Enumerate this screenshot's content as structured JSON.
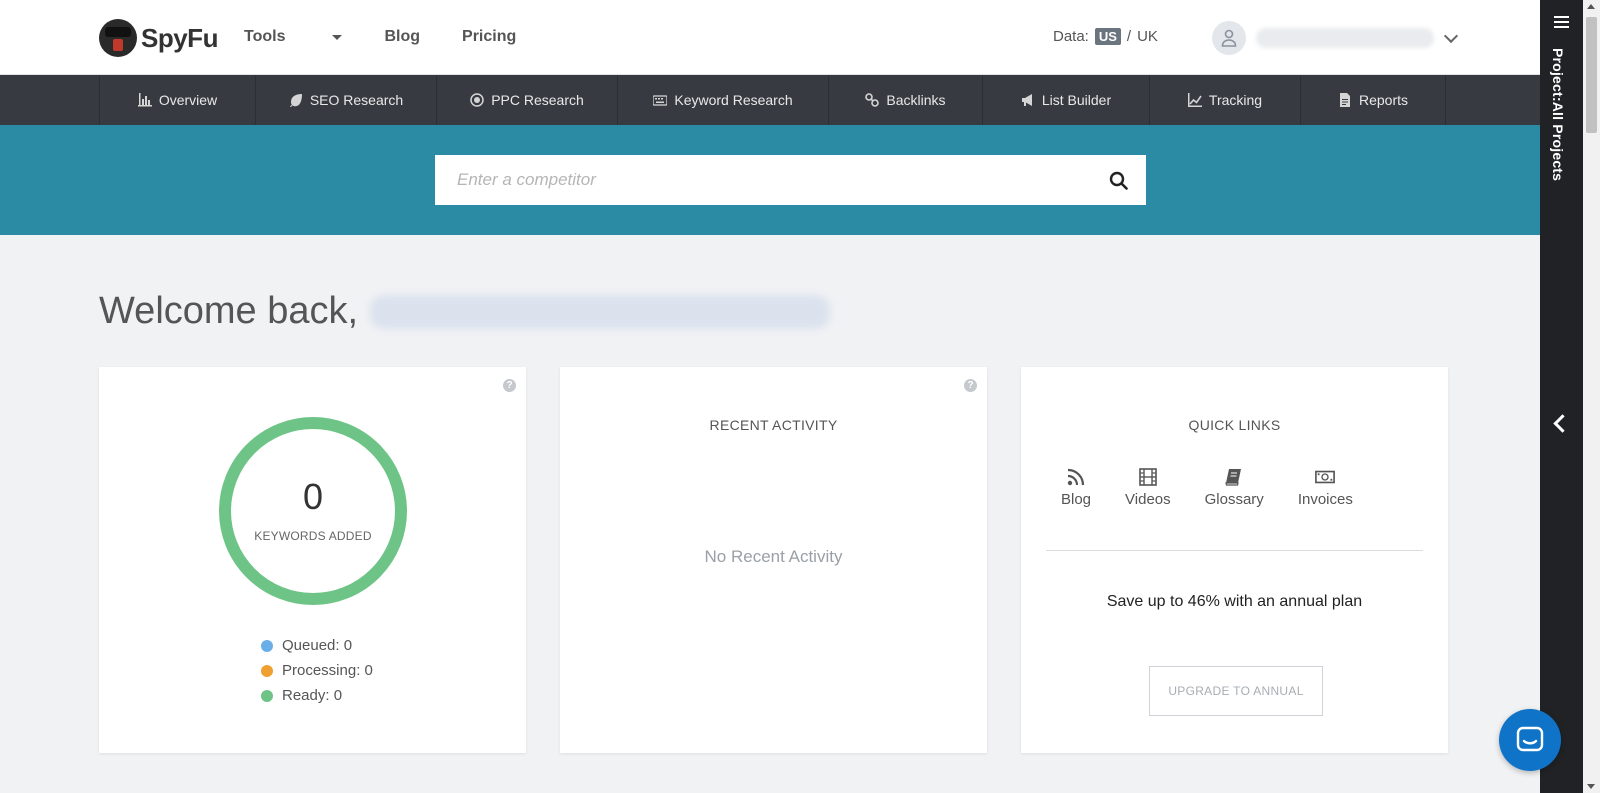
{
  "header": {
    "logo_text": "SpyFu",
    "nav": [
      {
        "label": "Tools"
      },
      {
        "label": "Blog"
      },
      {
        "label": "Pricing"
      }
    ],
    "data_label": "Data:",
    "data_us": "US",
    "data_sep": "/",
    "data_uk": "UK"
  },
  "toolnav": [
    {
      "label": "Overview",
      "icon": "bar-chart-icon"
    },
    {
      "label": "SEO Research",
      "icon": "leaf-icon"
    },
    {
      "label": "PPC Research",
      "icon": "target-icon"
    },
    {
      "label": "Keyword Research",
      "icon": "keyboard-icon"
    },
    {
      "label": "Backlinks",
      "icon": "link-icon"
    },
    {
      "label": "List Builder",
      "icon": "megaphone-icon"
    },
    {
      "label": "Tracking",
      "icon": "line-chart-icon"
    },
    {
      "label": "Reports",
      "icon": "document-icon"
    }
  ],
  "search": {
    "placeholder": "Enter a competitor"
  },
  "welcome": {
    "text": "Welcome back,"
  },
  "keywords_card": {
    "count": "0",
    "label": "KEYWORDS ADDED",
    "legend": [
      {
        "label": "Queued: 0",
        "color": "#6aaee8"
      },
      {
        "label": "Processing: 0",
        "color": "#f0a030"
      },
      {
        "label": "Ready: 0",
        "color": "#6ec486"
      }
    ],
    "ring_color": "#6ec486"
  },
  "activity_card": {
    "title": "RECENT ACTIVITY",
    "empty": "No Recent Activity"
  },
  "quicklinks_card": {
    "title": "QUICK LINKS",
    "links": [
      {
        "label": "Blog",
        "icon": "rss-icon"
      },
      {
        "label": "Videos",
        "icon": "film-icon"
      },
      {
        "label": "Glossary",
        "icon": "book-icon"
      },
      {
        "label": "Invoices",
        "icon": "money-icon"
      }
    ],
    "promo": "Save up to 46% with an annual plan",
    "upgrade_label": "UPGRADE TO ANNUAL"
  },
  "sidebar": {
    "project_label": "Project:All Projects"
  },
  "colors": {
    "band": "#2b8aa4",
    "toolnav": "#373b41",
    "sidebar": "#202225",
    "chat": "#0f74c8"
  }
}
